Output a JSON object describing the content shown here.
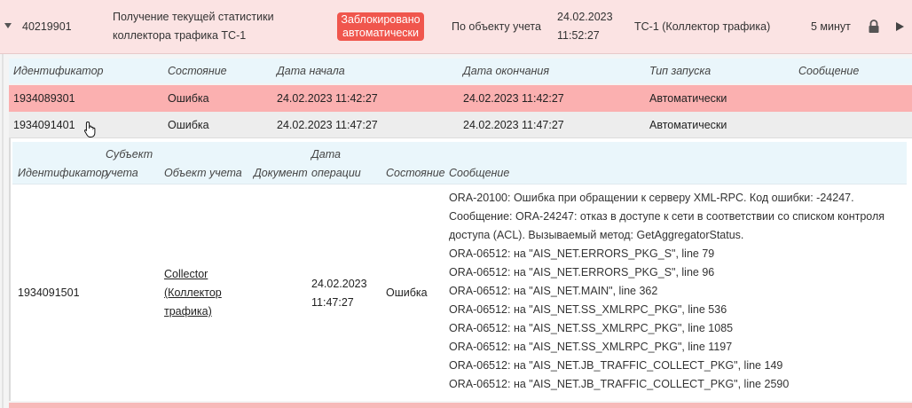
{
  "task": {
    "id": "40219901",
    "title_line1": "Получение текущей статистики",
    "title_line2": "коллектора трафика ТС-1",
    "badge_line1": "Заблокировано",
    "badge_line2": "автоматически",
    "scope": "По объекту учета",
    "date": "24.02.2023",
    "time": "11:52:27",
    "collector_link": "ТС-1 (Коллектор трафика)",
    "interval": "5 минут",
    "icons": {
      "expand": "caret-down-icon",
      "lock": "lock-icon",
      "run": "play-icon"
    }
  },
  "executions": {
    "headers": [
      "Идентификатор",
      "Состояние",
      "Дата начала",
      "Дата окончания",
      "Тип запуска",
      "Сообщение"
    ],
    "rows": [
      {
        "id": "1934089301",
        "state": "Ошибка",
        "start": "24.02.2023 11:42:27",
        "end": "24.02.2023 11:42:27",
        "launch": "Автоматически",
        "message": ""
      },
      {
        "id": "1934091401",
        "state": "Ошибка",
        "start": "24.02.2023 11:47:27",
        "end": "24.02.2023 11:47:27",
        "launch": "Автоматически",
        "message": ""
      }
    ]
  },
  "details": {
    "headers": {
      "id": "Идентификатор",
      "subject_l1": "Субъект",
      "subject_l2": "учета",
      "object": "Объект учета",
      "document": "Документ",
      "opdate_l1": "Дата",
      "opdate_l2": "операции",
      "state": "Состояние",
      "message": "Сообщение"
    },
    "row": {
      "id": "1934091501",
      "object_l1": "Collector",
      "object_l2": "(Коллектор",
      "object_l3": "трафика)",
      "date": "24.02.2023",
      "time": "11:47:27",
      "state": "Ошибка",
      "message_lines": [
        "ORA-20100: Ошибка при обращении к серверу XML-RPC. Код ошибки: -24247.",
        "Сообщение: ORA-24247: отказ в доступе к сети в соответствии со списком контроля",
        "доступа (ACL). Вызываемый метод: GetAggregatorStatus.",
        "ORA-06512: на \"AIS_NET.ERRORS_PKG_S\", line 79",
        "ORA-06512: на \"AIS_NET.ERRORS_PKG_S\", line 96",
        "ORA-06512: на \"AIS_NET.MAIN\", line 362",
        "ORA-06512: на \"AIS_NET.SS_XMLRPC_PKG\", line 536",
        "ORA-06512: на \"AIS_NET.SS_XMLRPC_PKG\", line 1085",
        "ORA-06512: на \"AIS_NET.SS_XMLRPC_PKG\", line 1197",
        "ORA-06512: на \"AIS_NET.JB_TRAFFIC_COLLECT_PKG\", line 149",
        "ORA-06512: на \"AIS_NET.JB_TRAFFIC_COLLECT_PKG\", line 2590"
      ]
    }
  },
  "colors": {
    "task_row_bg": "#fbe3e3",
    "badge_bg": "#f0564d",
    "error_row_bg": "#fbb0b0",
    "header_bg": "#eaf6fb",
    "link": "#1a7fc8"
  }
}
